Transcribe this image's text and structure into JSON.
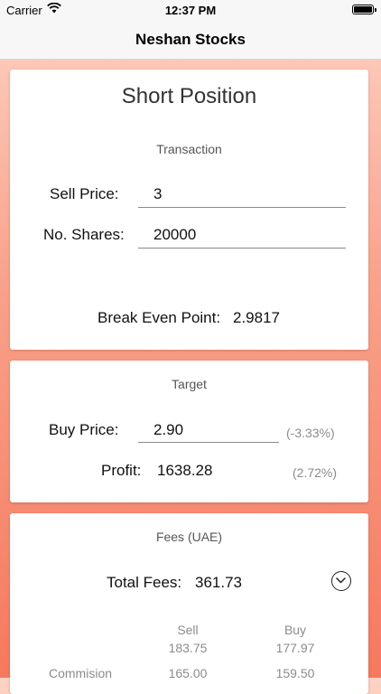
{
  "status_bar": {
    "carrier": "Carrier",
    "time": "12:37 PM",
    "wifi_icon": "wifi-icon",
    "battery_icon": "battery-icon"
  },
  "nav": {
    "title": "Neshan Stocks"
  },
  "position_card": {
    "title": "Short Position",
    "section": "Transaction",
    "sell_price_label": "Sell Price:",
    "sell_price_value": "3",
    "shares_label": "No. Shares:",
    "shares_value": "20000",
    "break_even_label": "Break Even Point:",
    "break_even_value": "2.9817"
  },
  "target_card": {
    "section": "Target",
    "buy_price_label": "Buy Price:",
    "buy_price_value": "2.90",
    "buy_change": "(-3.33%)",
    "profit_label": "Profit:",
    "profit_value": "1638.28",
    "profit_pct": "(2.72%)"
  },
  "fees_card": {
    "section": "Fees (UAE)",
    "total_label": "Total Fees:",
    "total_value": "361.73",
    "expand_icon": "chevron-down-icon",
    "columns": [
      "Sell",
      "Buy"
    ],
    "totals": [
      "183.75",
      "177.97"
    ],
    "rows": [
      {
        "label": "Commision",
        "sell": "165.00",
        "buy": "159.50"
      }
    ]
  }
}
